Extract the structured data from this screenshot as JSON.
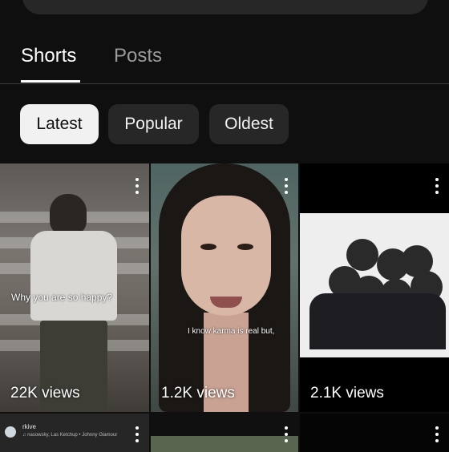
{
  "tabs": [
    {
      "label": "Shorts",
      "selected": true
    },
    {
      "label": "Posts",
      "selected": false
    }
  ],
  "filters": [
    {
      "label": "Latest",
      "selected": true
    },
    {
      "label": "Popular",
      "selected": false
    },
    {
      "label": "Oldest",
      "selected": false
    }
  ],
  "shorts": [
    {
      "views": "22K views",
      "caption": "Why you are so happy?"
    },
    {
      "views": "1.2K views",
      "caption": "I know karma is real but,"
    },
    {
      "views": "2.1K views",
      "caption": ""
    },
    {
      "channel": "rkive",
      "music": "♫ nasowsky, Las Ketchup • Johnny Glamour"
    }
  ],
  "colors": {
    "background": "#0f0f0f",
    "chip": "#272727",
    "chip_selected": "#f1f1f1"
  }
}
